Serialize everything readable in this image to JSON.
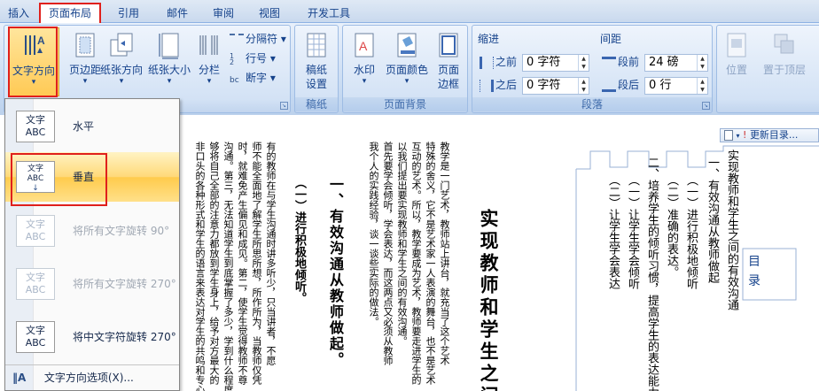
{
  "tabs": [
    {
      "label": "插入"
    },
    {
      "label": "页面布局",
      "active": true
    },
    {
      "label": "引用"
    },
    {
      "label": "邮件"
    },
    {
      "label": "审阅"
    },
    {
      "label": "视图"
    },
    {
      "label": "开发工具"
    }
  ],
  "ribbon": {
    "page_setup": {
      "text_direction": {
        "line1": "文字方向",
        "arrow": "▾"
      },
      "margins": {
        "line1": "页边距",
        "arrow": "▾"
      },
      "orientation": {
        "line1": "纸张方向",
        "arrow": "▾"
      },
      "size": {
        "line1": "纸张大小",
        "arrow": "▾"
      },
      "columns": {
        "line1": "分栏",
        "arrow": "▾"
      },
      "breaks": "分隔符 ▾",
      "line_numbers": "行号 ▾",
      "hyphenation": "断字 ▾"
    },
    "manuscript": {
      "btn_line1": "稿纸",
      "btn_line2": "设置",
      "title": "稿纸"
    },
    "page_background": {
      "watermark": {
        "line1": "水印",
        "arrow": "▾"
      },
      "page_color": {
        "line1": "页面颜色",
        "arrow": "▾"
      },
      "page_border": {
        "line1": "页面",
        "line2": "边框"
      },
      "title": "页面背景"
    },
    "paragraph": {
      "indent_label": "缩进",
      "spacing_label": "间距",
      "before_indent_label": "之前",
      "before_indent_value": "0 字符",
      "after_indent_label": "之后",
      "after_indent_value": "0 字符",
      "before_spacing_label": "段前",
      "before_spacing_value": "24 磅",
      "after_spacing_label": "段后",
      "after_spacing_value": "0 行",
      "title": "段落"
    },
    "arrange": {
      "position": "位置",
      "bring_front": "置于顶层"
    }
  },
  "text_direction_menu": {
    "items": [
      {
        "icon_top": "文字",
        "icon_bottom": "ABC",
        "label": "水平",
        "state": "normal"
      },
      {
        "icon_top": "文字",
        "icon_bottom": "ABC",
        "label": "垂直",
        "state": "selected"
      },
      {
        "icon_top": "文字",
        "icon_bottom": "ABC",
        "label": "将所有文字旋转 90°",
        "state": "disabled"
      },
      {
        "icon_top": "文字",
        "icon_bottom": "ABC",
        "label": "将所有文字旋转 270°",
        "state": "disabled"
      },
      {
        "icon_top": "文字",
        "icon_bottom": "ABC",
        "label": "将中文字符旋转 270°",
        "state": "normal"
      }
    ],
    "options_label": "文字方向选项(X)..."
  },
  "document": {
    "title": "实现教师和学生之间",
    "heading1": "一、有效沟通从教师做起。",
    "heading2": "（一）进行积极地倾听。",
    "para_intro": [
      "教学是一门艺术，教师站上讲台，就充当了这个艺术",
      "特殊的舍义，它不是艺术家一人表演的舞台，也不是艺术",
      "互动的艺术。所以，教学要成为艺术，教师要走进学生的",
      "以我们提出要实现教师和学生之间的有效沟通。",
      "首先要学会倾听，学会表达，而这两点又必须从教师",
      "我个人的实践经验，谈一谈些实际的做法。"
    ],
    "para_body": [
      "有的教师在与学生沟通时讲多听少，只当讲者，不愿",
      "师不能全面地了解学生所思所想，所作所为，当教师仅凭",
      "时，就难免产生偏见和成见。第二，使学生觉得教师不尊",
      "沟通。第三，无法知道学生到底掌握了多少，学到什么程度",
      "够将自己全部的注意力都放到学生身上，给予对方最大的",
      "非口头的各种形式和学生的语言来表达对学生的共鸣和专心，比如点"
    ]
  },
  "toc": {
    "toolbar_update": "更新目录...",
    "tab_label": "目 录",
    "entries": [
      "一、有效沟通从教师做起",
      "（一）进行积极地倾听",
      "（二）准确的表达。",
      "二、培养学生的倾听习惯，提高学生的表达能力。",
      "（一）让学生学会倾听",
      "（二）让学生学会表达"
    ],
    "title_partial": "实现教师和学生之间的有效沟通"
  }
}
